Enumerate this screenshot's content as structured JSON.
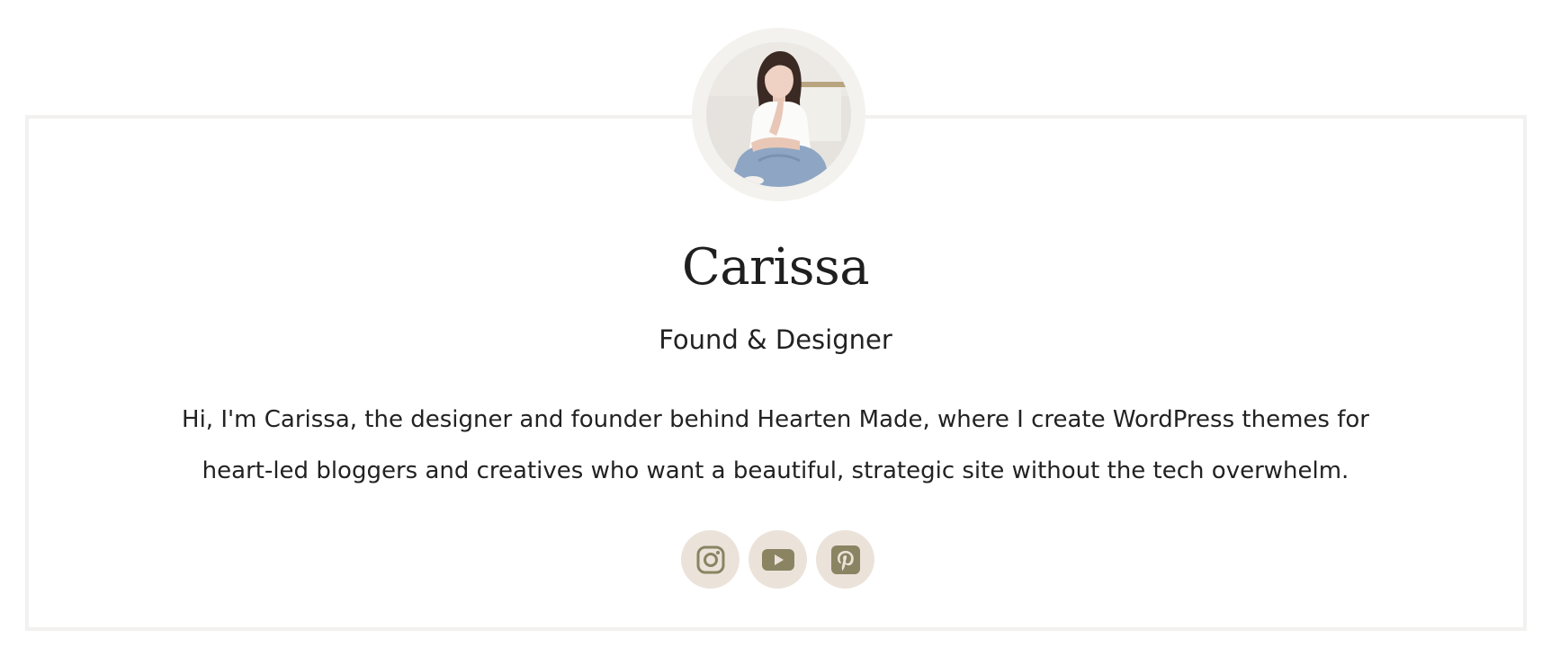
{
  "profile": {
    "name": "Carissa",
    "role": "Found & Designer",
    "bio": "Hi, I'm Carissa, the designer and founder behind Hearten Made, where I create WordPress themes for heart-led bloggers and creatives who want a beautiful, strategic site without the tech overwhelm."
  },
  "social": {
    "items": [
      {
        "icon": "instagram-icon"
      },
      {
        "icon": "youtube-icon"
      },
      {
        "icon": "pinterest-icon"
      }
    ]
  },
  "colors": {
    "card_border": "#f2f1ef",
    "avatar_ring": "#f3f2ee",
    "social_bg": "#ebe3da",
    "social_icon": "#8a8462",
    "text": "#222222"
  }
}
